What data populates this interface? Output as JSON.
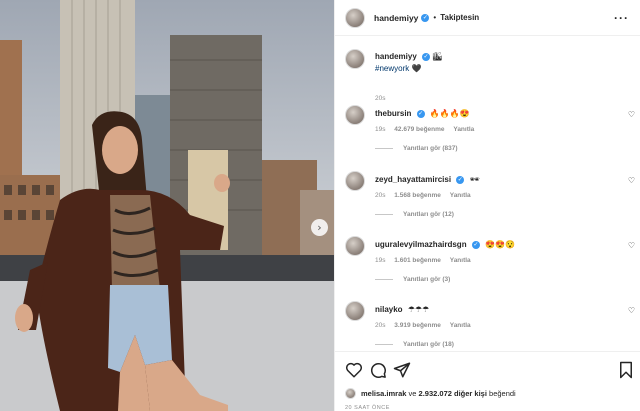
{
  "header": {
    "username": "handemiyy",
    "separator": "•",
    "follow_label": "Takiptesin",
    "more_label": "···",
    "verified_mark": "✓"
  },
  "caption": {
    "username": "handemiyy",
    "emoji": "🏙",
    "hashtag": "#newyork",
    "hashtag_emoji": "🖤",
    "time": "20s"
  },
  "comments": [
    {
      "username": "thebursin",
      "verified": true,
      "text": "🔥🔥🔥😍",
      "time": "19s",
      "likes": "42.679 beğenme",
      "reply": "Yanıtla",
      "view_replies": "Yanıtları gör (837)"
    },
    {
      "username": "zeyd_hayattamircisi",
      "verified": true,
      "text": "🕶",
      "time": "20s",
      "likes": "1.568 beğenme",
      "reply": "Yanıtla",
      "view_replies": "Yanıtları gör (12)"
    },
    {
      "username": "uguralevyilmazhairdsgn",
      "verified": true,
      "text": "😍😍😯",
      "time": "19s",
      "likes": "1.601 beğenme",
      "reply": "Yanıtla",
      "view_replies": "Yanıtları gör (3)"
    },
    {
      "username": "nilayko",
      "verified": false,
      "text": "☂☂☂",
      "time": "20s",
      "likes": "3.919 beğenme",
      "reply": "Yanıtla",
      "view_replies": "Yanıtları gör (18)"
    }
  ],
  "actions": {
    "like_icon": "heart-icon",
    "comment_icon": "comment-icon",
    "share_icon": "share-icon",
    "save_icon": "bookmark-icon",
    "liker_name": "melisa.imrak",
    "likes_middle": " ve ",
    "likes_count": "2.932.072 diğer kişi",
    "likes_suffix": " beğendi",
    "date": "20 SAAT ÖNCE"
  },
  "colors": {
    "link": "#00376b",
    "verified": "#3897f0",
    "muted": "#8e8e8e",
    "text": "#262626"
  }
}
